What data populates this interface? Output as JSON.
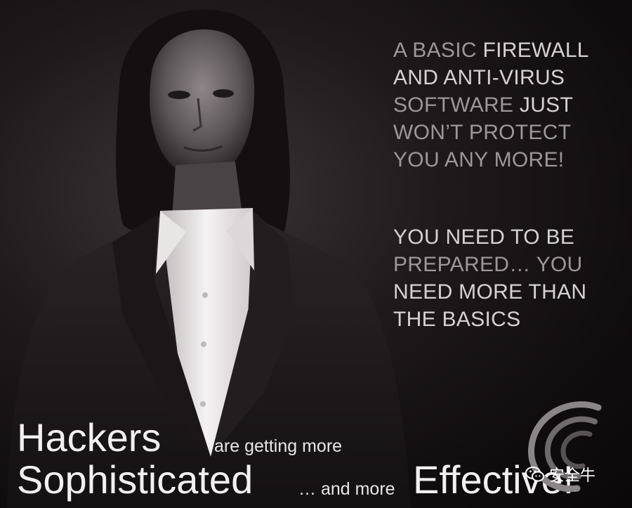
{
  "headline": {
    "block1": [
      [
        "A BASIC ",
        "FIREWALL"
      ],
      [
        "AND ANTI-VIRUS",
        ""
      ],
      [
        "SOFTWARE ",
        "JUST"
      ],
      [
        "WON’T PROTECT",
        ""
      ],
      [
        "YOU ANY MORE!",
        ""
      ]
    ],
    "block2": [
      "YOU NEED TO BE",
      "PREPARED… YOU",
      "NEED MORE THAN",
      "THE BASICS"
    ]
  },
  "tagline": {
    "word1": "Hackers",
    "phrase1": "are getting more",
    "word2": "Sophisticated",
    "phrase2": "… and more",
    "word3": "Effective!"
  },
  "watermark": {
    "icon": "wechat-icon",
    "text": "安全牛"
  },
  "colors": {
    "background": "#0d0b0c",
    "text_light": "#f2f0f0",
    "text_dim": "#9c9798"
  }
}
